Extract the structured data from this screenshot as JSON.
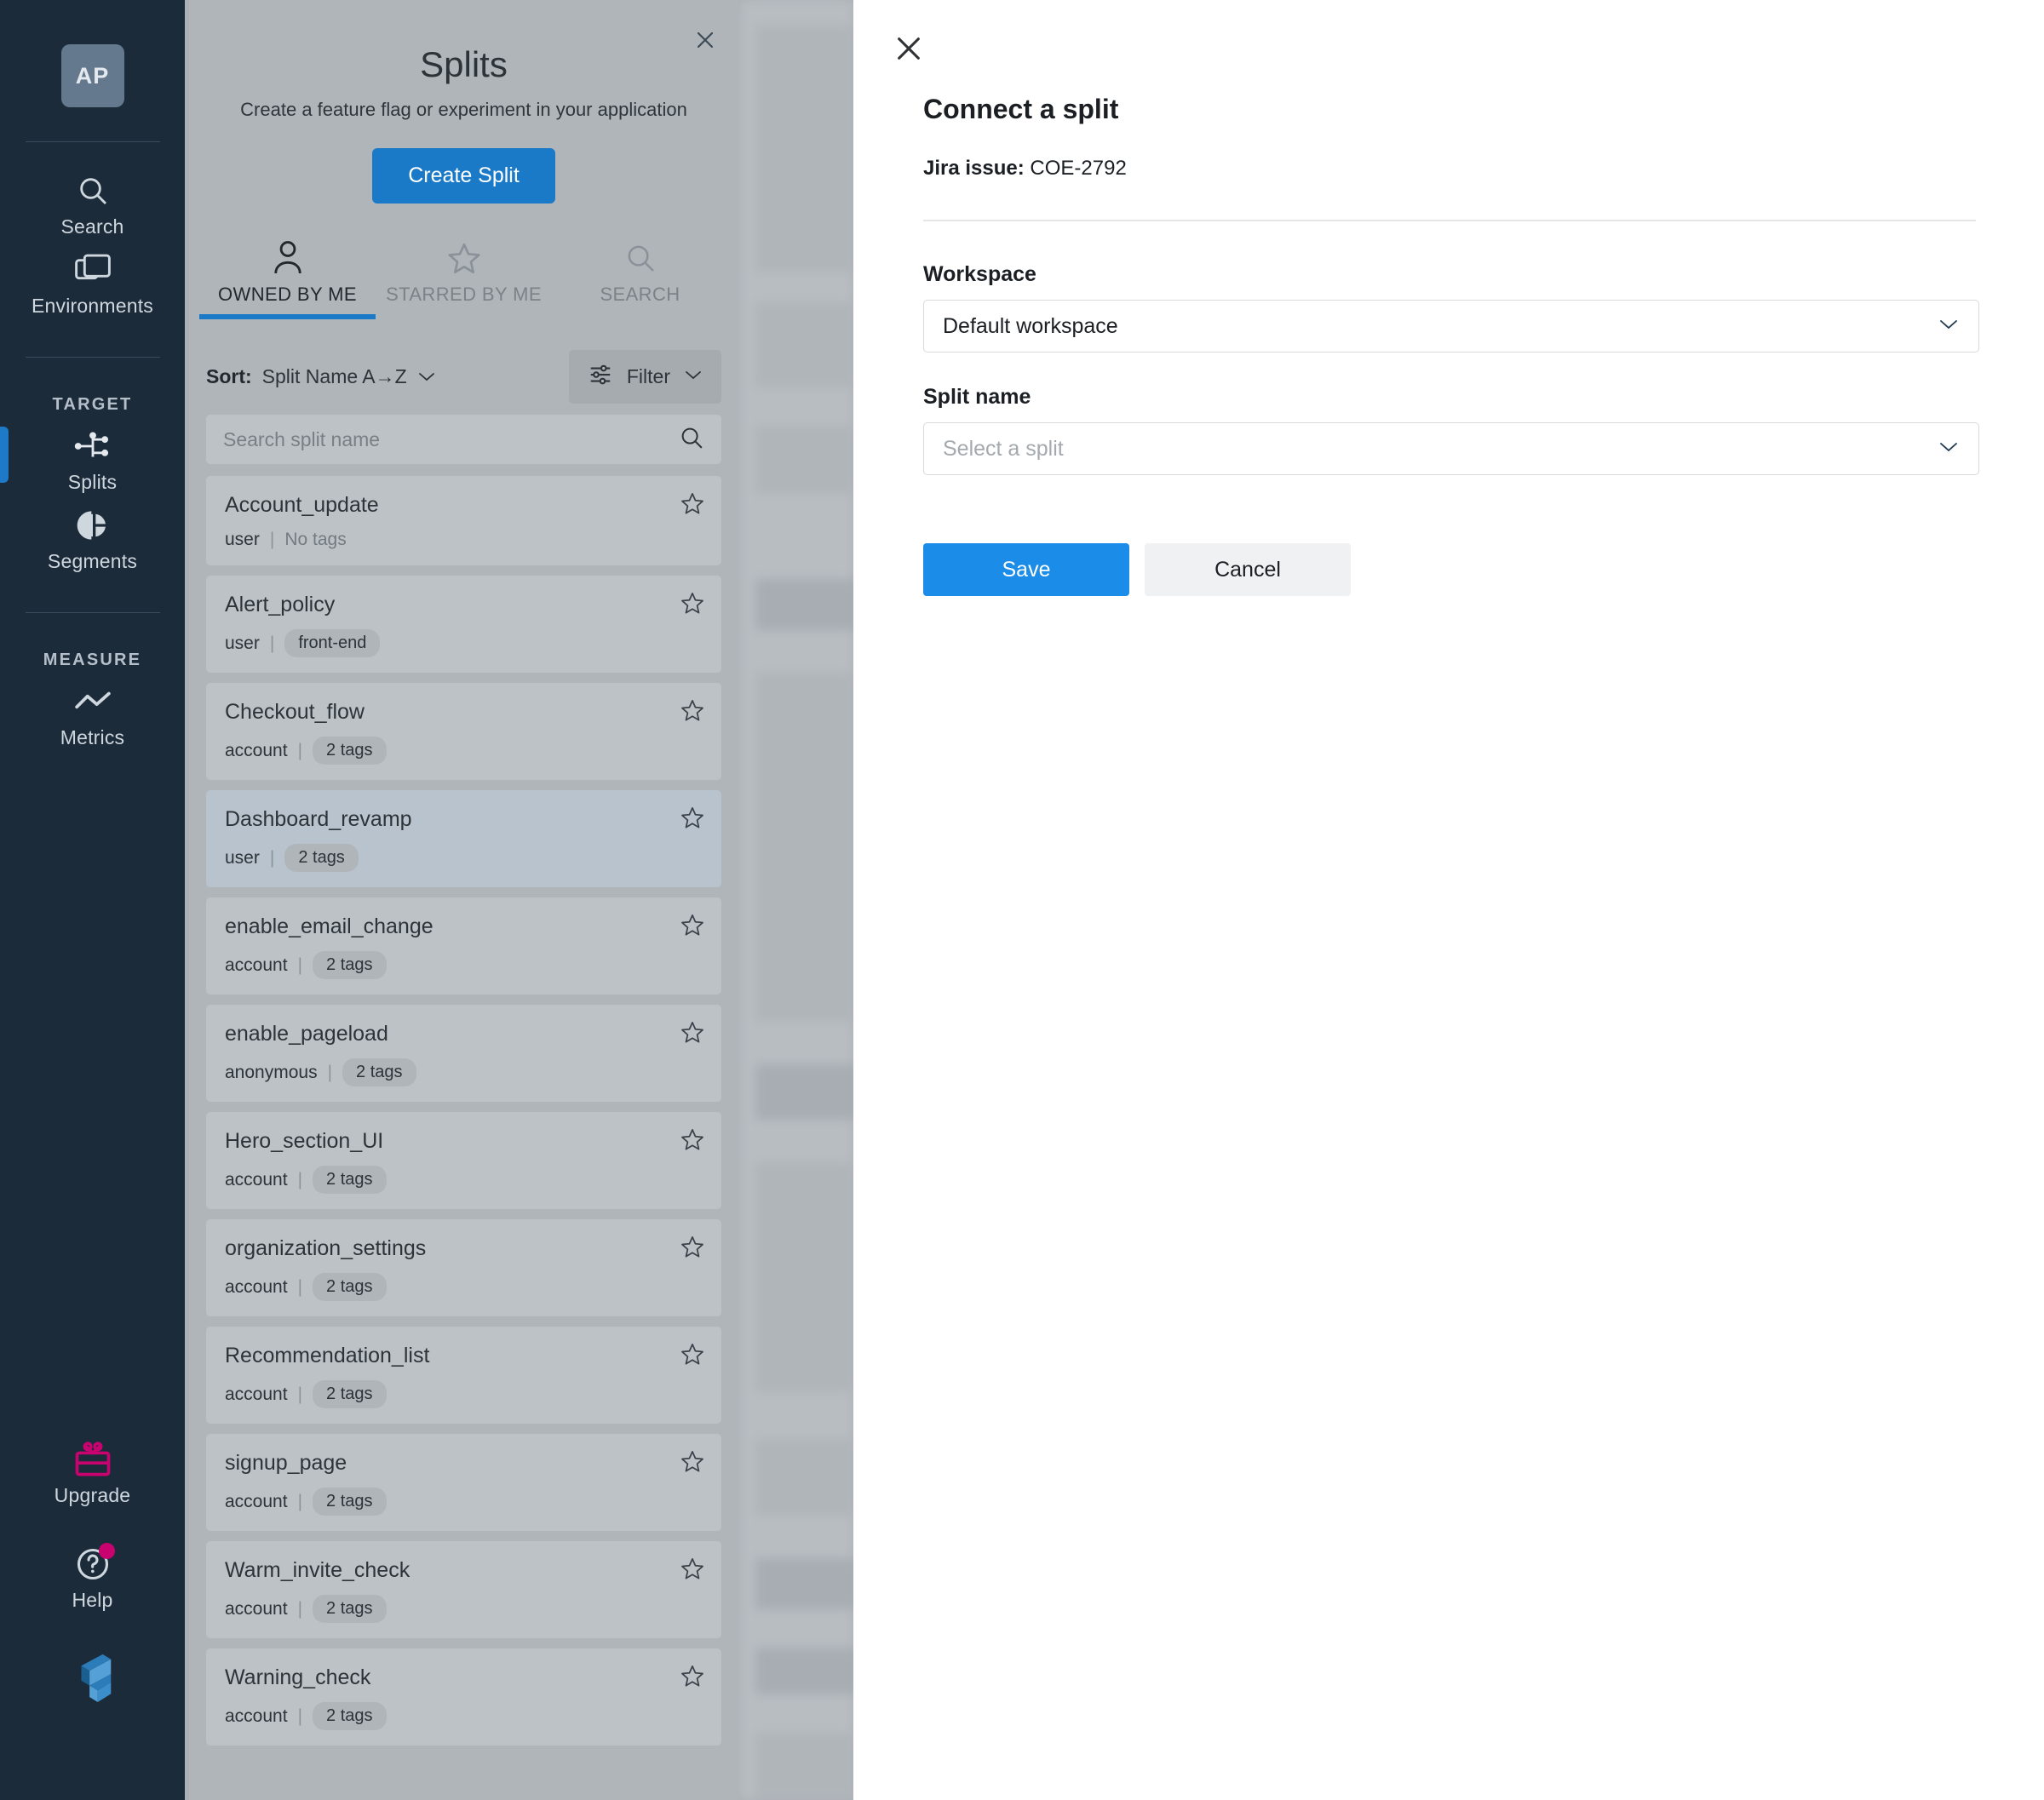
{
  "sidebar": {
    "avatar_initials": "AP",
    "items": [
      {
        "label": "Search",
        "icon": "search-icon"
      },
      {
        "label": "Environments",
        "icon": "environments-icon"
      }
    ],
    "sections": [
      {
        "title": "TARGET",
        "items": [
          {
            "label": "Splits",
            "icon": "splits-icon",
            "active": true
          },
          {
            "label": "Segments",
            "icon": "segments-icon",
            "active": false
          }
        ]
      },
      {
        "title": "MEASURE",
        "items": [
          {
            "label": "Metrics",
            "icon": "metrics-icon",
            "active": false
          }
        ]
      }
    ],
    "upgrade_label": "Upgrade",
    "help_label": "Help",
    "accent_active": "#1e7ac8",
    "accent_pink": "#c8036f",
    "background": "#1c2b3a"
  },
  "splits_panel": {
    "title": "Splits",
    "subtitle": "Create a feature flag or experiment in your application",
    "create_button": "Create Split",
    "close_icon": "close-icon",
    "tabs": [
      {
        "label": "OWNED BY ME",
        "icon": "person-icon",
        "active": true
      },
      {
        "label": "STARRED BY ME",
        "icon": "star-icon",
        "active": false
      },
      {
        "label": "SEARCH",
        "icon": "search-icon",
        "active": false
      }
    ],
    "sort_label": "Sort:",
    "sort_value": "Split Name A→Z",
    "filter_label": "Filter",
    "search_placeholder": "Search split name",
    "items": [
      {
        "name": "Account_update",
        "owner": "user",
        "tags": "No tags",
        "tag_style": "none",
        "selected": false
      },
      {
        "name": "Alert_policy",
        "owner": "user",
        "tags": "front-end",
        "tag_style": "pill",
        "selected": false
      },
      {
        "name": "Checkout_flow",
        "owner": "account",
        "tags": "2 tags",
        "tag_style": "pill",
        "selected": false
      },
      {
        "name": "Dashboard_revamp",
        "owner": "user",
        "tags": "2 tags",
        "tag_style": "pill",
        "selected": true
      },
      {
        "name": "enable_email_change",
        "owner": "account",
        "tags": "2 tags",
        "tag_style": "pill",
        "selected": false
      },
      {
        "name": "enable_pageload",
        "owner": "anonymous",
        "tags": "2 tags",
        "tag_style": "pill",
        "selected": false
      },
      {
        "name": "Hero_section_UI",
        "owner": "account",
        "tags": "2 tags",
        "tag_style": "pill",
        "selected": false
      },
      {
        "name": "organization_settings",
        "owner": "account",
        "tags": "2 tags",
        "tag_style": "pill",
        "selected": false
      },
      {
        "name": "Recommendation_list",
        "owner": "account",
        "tags": "2 tags",
        "tag_style": "pill",
        "selected": false
      },
      {
        "name": "signup_page",
        "owner": "account",
        "tags": "2 tags",
        "tag_style": "pill",
        "selected": false
      },
      {
        "name": "Warm_invite_check",
        "owner": "account",
        "tags": "2 tags",
        "tag_style": "pill",
        "selected": false
      },
      {
        "name": "Warning_check",
        "owner": "account",
        "tags": "2 tags",
        "tag_style": "pill",
        "selected": false
      }
    ],
    "accent": "#1b7ac8"
  },
  "modal": {
    "close_icon": "close-icon",
    "title": "Connect a split",
    "jira_label": "Jira issue:",
    "jira_value": "COE-2792",
    "workspace_label": "Workspace",
    "workspace_value": "Default workspace",
    "split_name_label": "Split name",
    "split_name_placeholder": "Select a split",
    "save_label": "Save",
    "cancel_label": "Cancel",
    "save_color": "#1b8ce8"
  }
}
